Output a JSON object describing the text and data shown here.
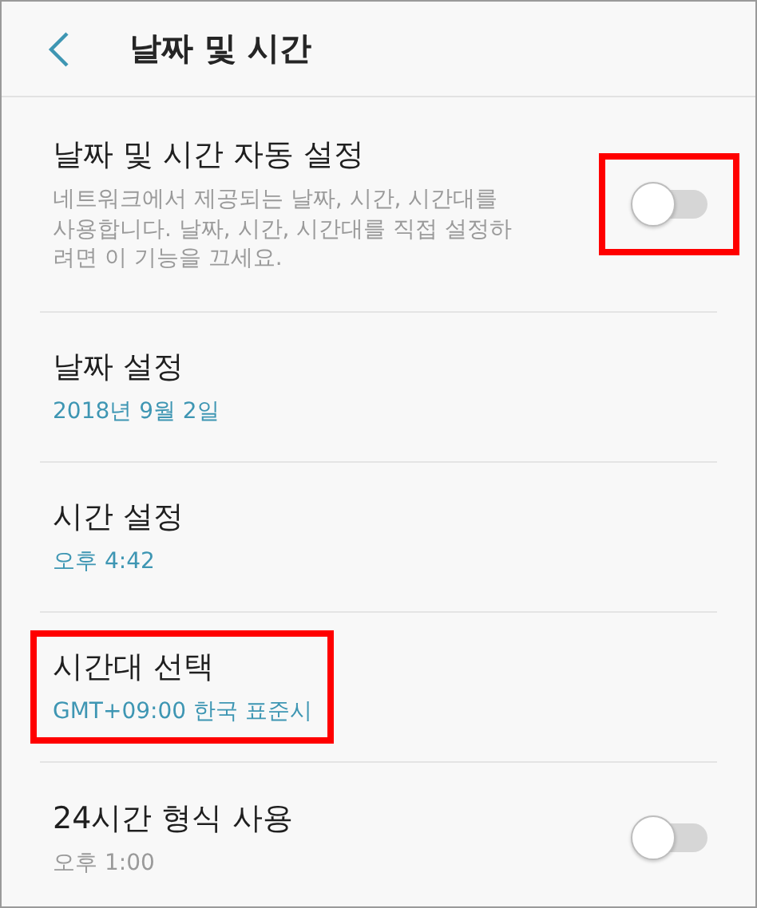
{
  "header": {
    "title": "날짜 및 시간"
  },
  "items": [
    {
      "kind": "toggle",
      "title": "날짜 및 시간 자동 설정",
      "subtitle": "네트워크에서 제공되는 날짜, 시간, 시간대를 사용합니다. 날짜, 시간, 시간대를 직접 설정하려면 이 기능을 끄세요.",
      "on": false,
      "highlighted": true
    },
    {
      "kind": "value",
      "title": "날짜 설정",
      "subtitle": "2018년 9월 2일",
      "highlighted": false
    },
    {
      "kind": "value",
      "title": "시간 설정",
      "subtitle": "오후 4:42",
      "highlighted": false
    },
    {
      "kind": "value",
      "title": "시간대 선택",
      "subtitle": "GMT+09:00 한국 표준시",
      "highlighted": true
    },
    {
      "kind": "toggle",
      "title": "24시간 형식 사용",
      "subtitle": "오후 1:00",
      "on": false,
      "highlighted": false
    }
  ]
}
